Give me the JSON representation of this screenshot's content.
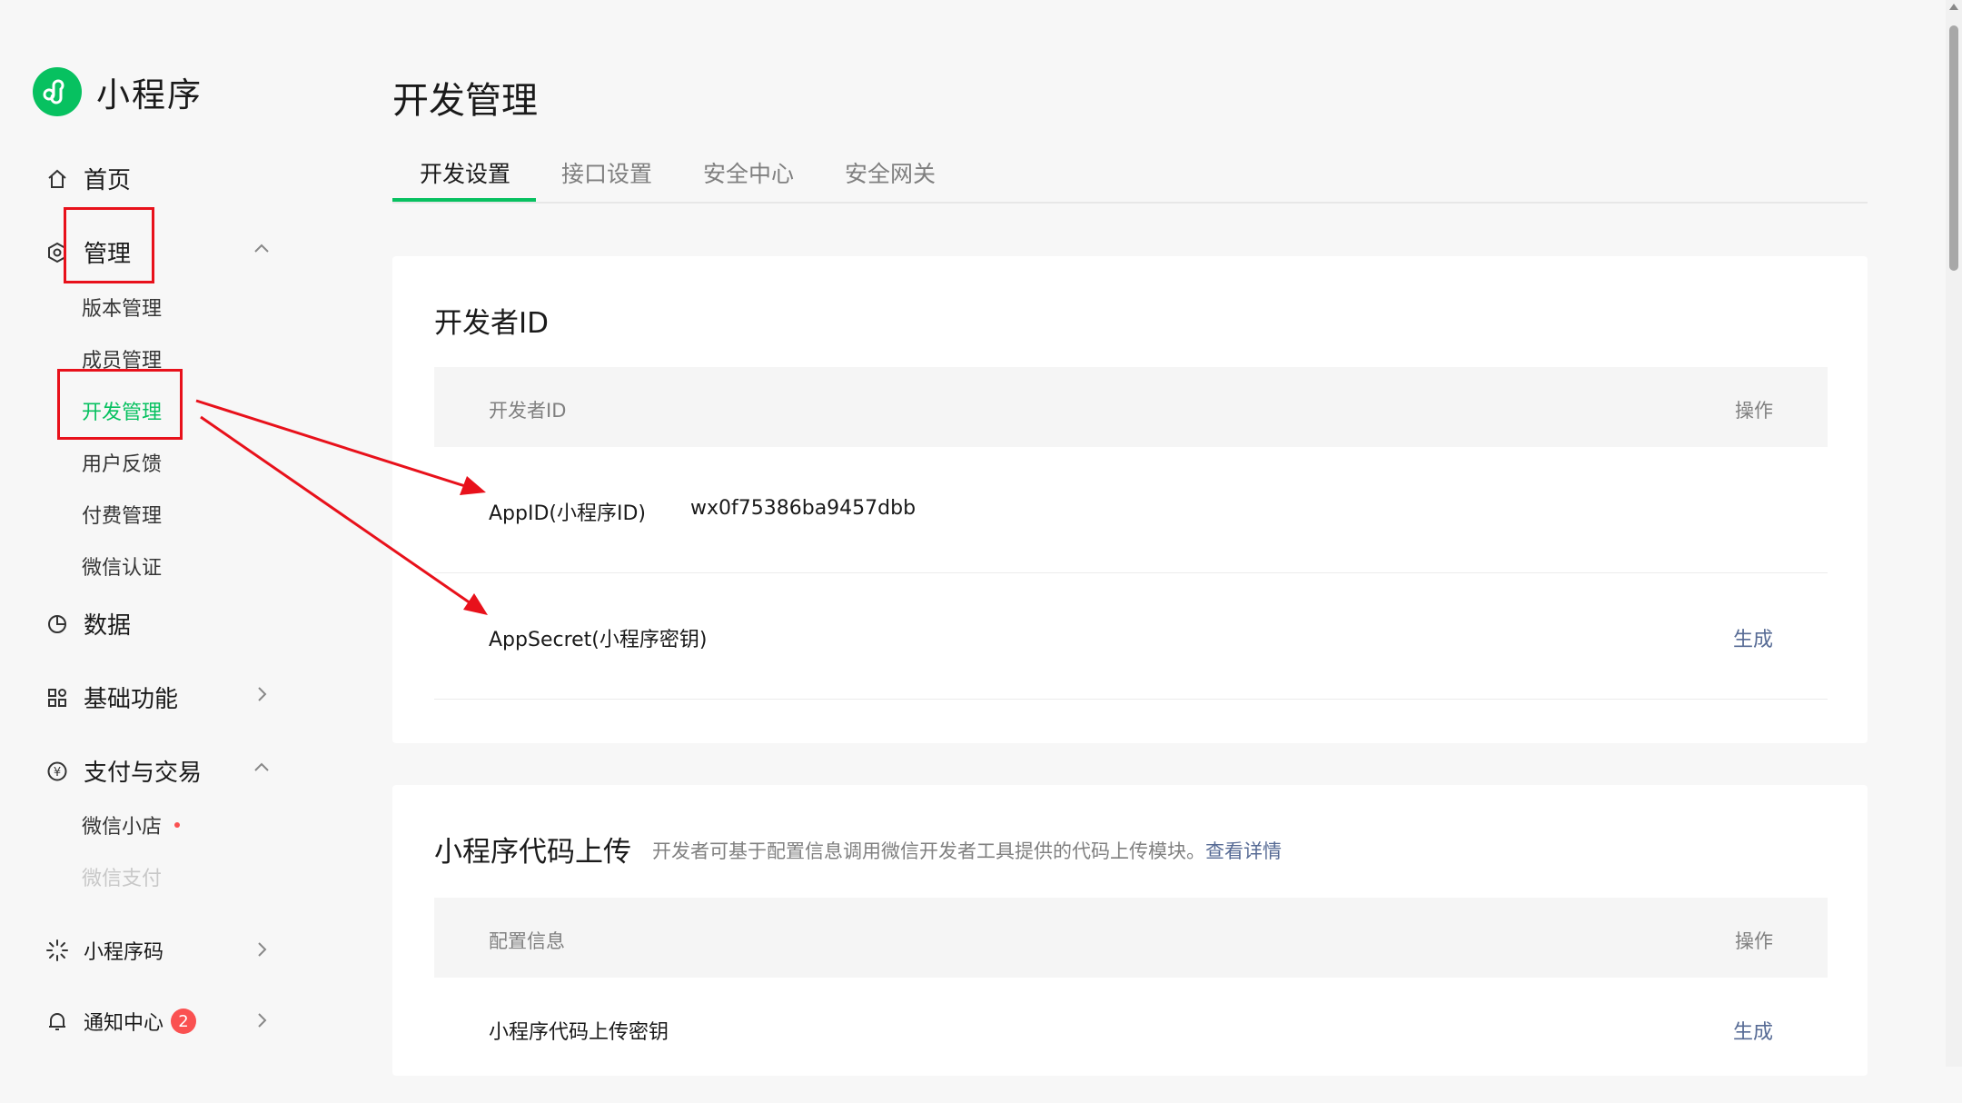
{
  "app": {
    "name": "小程序",
    "brand_color": "#07c160"
  },
  "sidebar": {
    "home": "首页",
    "manage": "管理",
    "manage_items": [
      "版本管理",
      "成员管理",
      "开发管理",
      "用户反馈",
      "付费管理",
      "微信认证"
    ],
    "data": "数据",
    "basic": "基础功能",
    "pay": "支付与交易",
    "pay_items": [
      "微信小店",
      "微信支付"
    ],
    "qrcode": "小程序码",
    "notice": "通知中心",
    "notice_badge": "2"
  },
  "page": {
    "title": "开发管理"
  },
  "tabs": [
    "开发设置",
    "接口设置",
    "安全中心",
    "安全网关"
  ],
  "developer_card": {
    "title": "开发者ID",
    "head_left": "开发者ID",
    "head_right": "操作",
    "rows": [
      {
        "label": "AppID(小程序ID)",
        "value": "wx0f75386ba9457dbb",
        "action": ""
      },
      {
        "label": "AppSecret(小程序密钥)",
        "value": "",
        "action": "生成"
      }
    ]
  },
  "upload_card": {
    "title": "小程序代码上传",
    "desc": "开发者可基于配置信息调用微信开发者工具提供的代码上传模块。",
    "desc_link": "查看详情",
    "head_left": "配置信息",
    "head_right": "操作",
    "rows": [
      {
        "label": "小程序代码上传密钥",
        "action": "生成"
      }
    ]
  },
  "annotation_color": "#e8111b"
}
